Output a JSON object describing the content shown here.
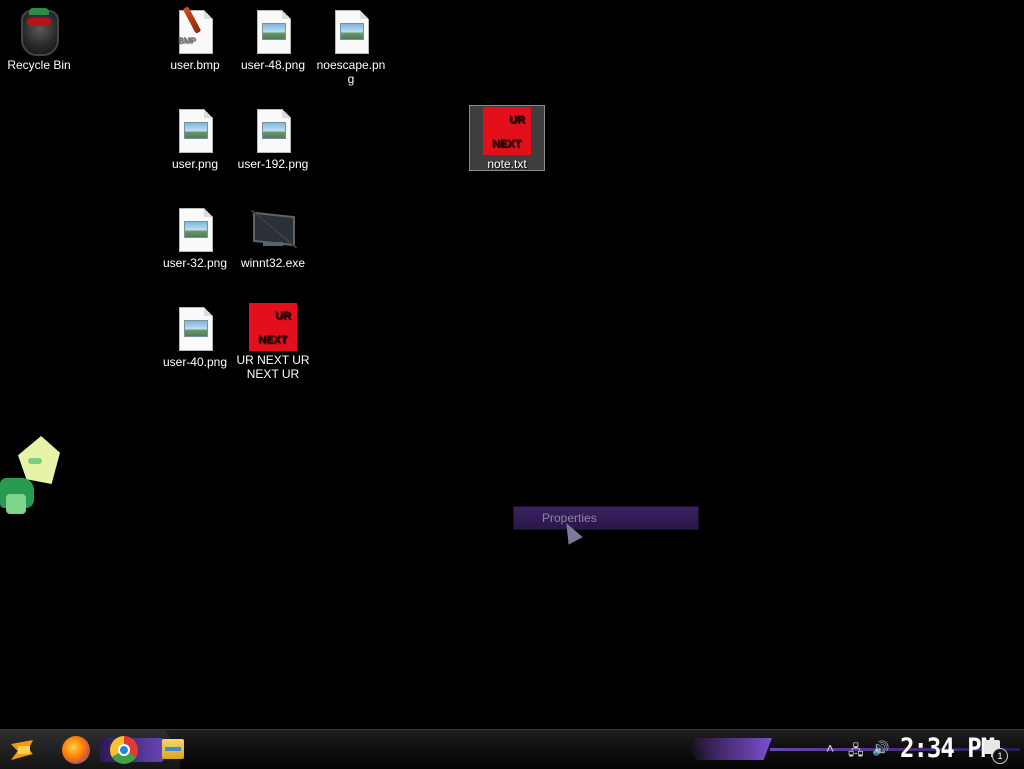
{
  "desktop": {
    "icons": [
      {
        "label": "Recycle Bin",
        "kind": "recycle-bin"
      },
      {
        "label": "user.bmp",
        "kind": "bmp-file",
        "badge": "BMP"
      },
      {
        "label": "user-48.png",
        "kind": "image-file"
      },
      {
        "label": "noescape.png",
        "kind": "image-file"
      },
      {
        "label": "user.png",
        "kind": "image-file"
      },
      {
        "label": "user-192.png",
        "kind": "image-file"
      },
      {
        "label": "note.txt",
        "kind": "ur-next-image",
        "selected": true
      },
      {
        "label": "user-32.png",
        "kind": "image-file"
      },
      {
        "label": "winnt32.exe",
        "kind": "monitor-exe"
      },
      {
        "label": "user-40.png",
        "kind": "image-file"
      },
      {
        "label": "UR NEXT UR NEXT UR NE...",
        "kind": "ur-next-image"
      }
    ],
    "ur_next_text": {
      "line1": "UR",
      "line2": "NEXT"
    }
  },
  "context_menu": {
    "items": [
      {
        "label": "Properties"
      }
    ]
  },
  "taskbar": {
    "apps": [
      {
        "name": "start-icon"
      },
      {
        "name": "firefox-icon"
      },
      {
        "name": "chrome-icon"
      },
      {
        "name": "file-explorer-icon"
      }
    ],
    "tray": {
      "clock": "2:34 PM",
      "notification_count": "1",
      "icons": [
        "chevron-up-icon",
        "network-icon",
        "volume-icon"
      ]
    }
  },
  "colors": {
    "accent": "#6a45b8",
    "ur_next_red": "#e3101c",
    "desktop_bg": "#000000"
  }
}
